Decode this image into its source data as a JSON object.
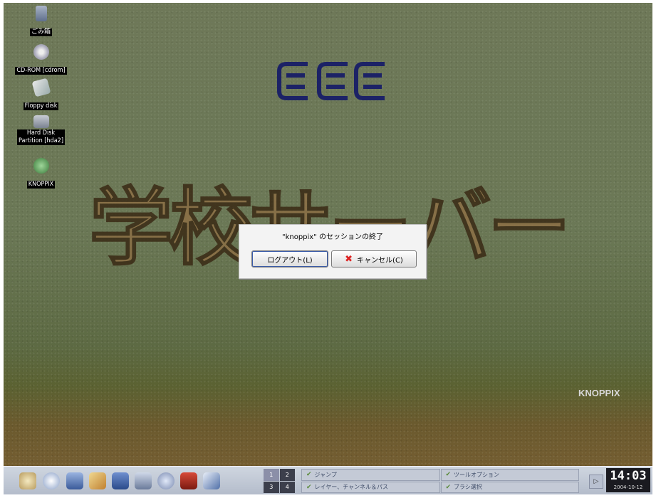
{
  "desktop": {
    "icons": [
      {
        "label": "ごみ箱",
        "icon": "trash-icon"
      },
      {
        "label": "CD-ROM [cdrom]",
        "icon": "cdrom-icon"
      },
      {
        "label": "Floppy disk",
        "icon": "floppy-icon"
      },
      {
        "label": "Hard Disk\nPartition [hda2]",
        "icon": "harddisk-icon"
      },
      {
        "label": "KNOPPIX",
        "icon": "knoppix-icon"
      }
    ],
    "logo_letters": "EEE",
    "banner": "学校サーバー",
    "watermark": "KNOPPIX"
  },
  "dialog": {
    "message": "\"knoppix\" のセッションの終了",
    "logout_label": "ログアウト(L)",
    "cancel_label": "キャンセル(C)"
  },
  "taskbar": {
    "launchers": [
      "kde-menu-icon",
      "home-icon",
      "terminal-icon",
      "konqueror-icon",
      "mail-icon",
      "editor-icon",
      "search-icon",
      "paint-icon",
      "pen-icon"
    ],
    "pager": [
      "1",
      "2",
      "3",
      "4"
    ],
    "tasks": [
      {
        "label": "ジャンプ"
      },
      {
        "label": "ツールオプション"
      },
      {
        "label": "レイヤー、チャンネル＆パス"
      },
      {
        "label": "ブラシ選択"
      }
    ],
    "clock_time": "14:03",
    "clock_date": "2004-10-12"
  },
  "colors": {
    "logo": "#1c2266",
    "banner": "#8c6f45",
    "taskbar": "#c4cad6"
  }
}
